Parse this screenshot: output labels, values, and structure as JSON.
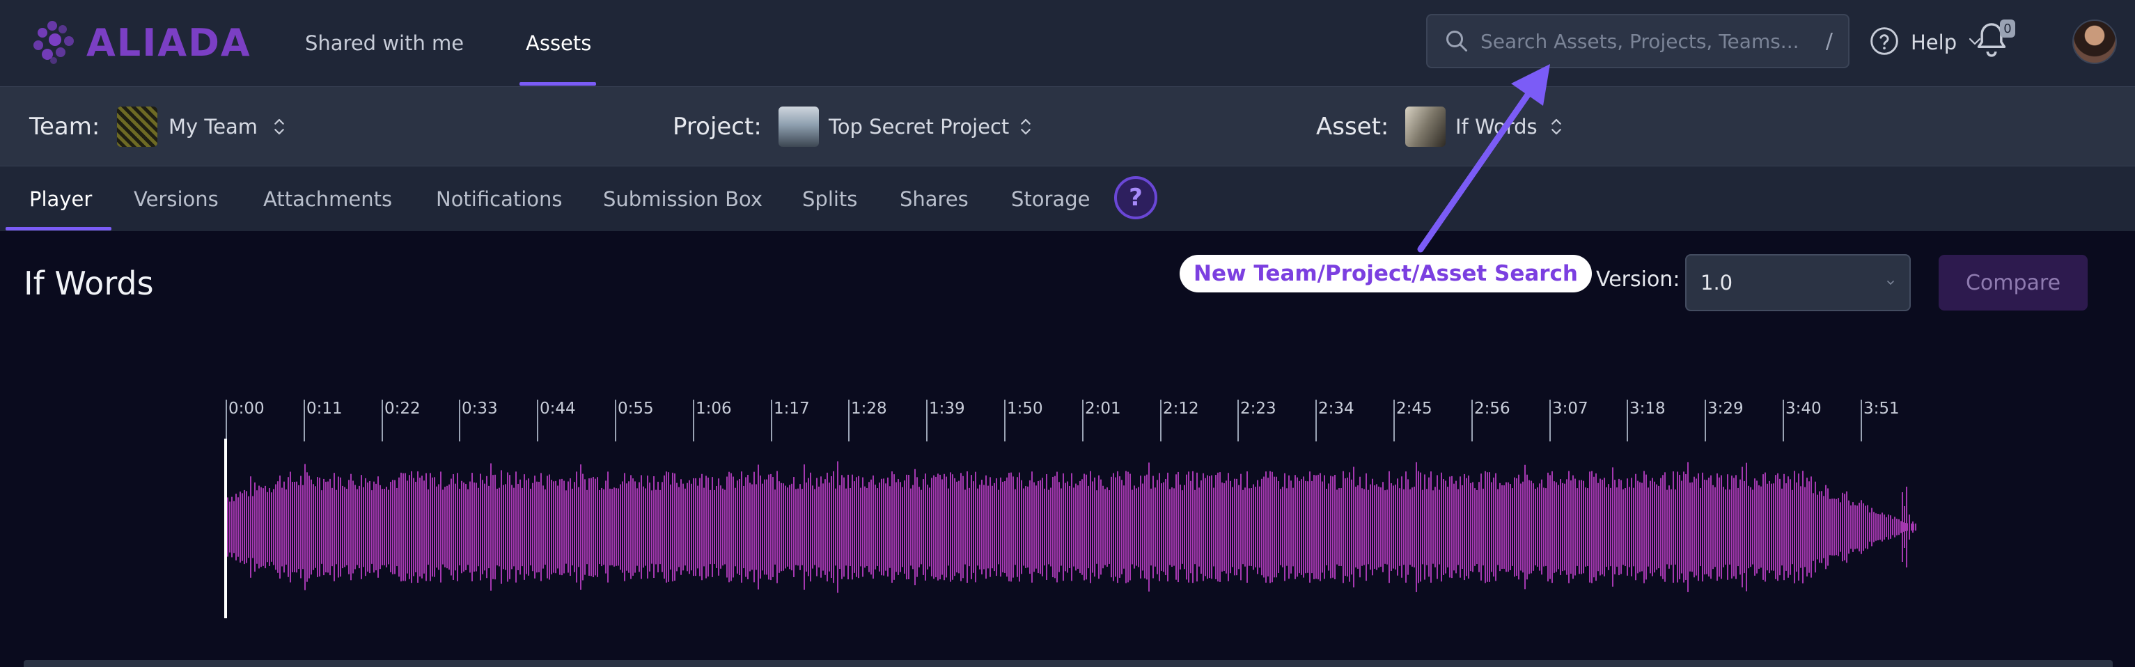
{
  "app": {
    "logo_text": "ALIADA",
    "accent": "#7b5cf6",
    "brand": "#7b3fc4"
  },
  "nav": {
    "shared_label": "Shared with me",
    "assets_label": "Assets"
  },
  "search": {
    "placeholder": "Search Assets, Projects, Teams...",
    "shortcut": "/"
  },
  "help": {
    "label": "Help"
  },
  "notifications": {
    "count": "0"
  },
  "context": {
    "team_label": "Team:",
    "team_value": "My Team",
    "project_label": "Project:",
    "project_value": "Top Secret Project",
    "asset_label": "Asset:",
    "asset_value": "If Words"
  },
  "tabs": [
    {
      "label": "Player"
    },
    {
      "label": "Versions"
    },
    {
      "label": "Attachments"
    },
    {
      "label": "Notifications"
    },
    {
      "label": "Submission Box"
    },
    {
      "label": "Splits"
    },
    {
      "label": "Shares"
    },
    {
      "label": "Storage"
    }
  ],
  "tab_help": "?",
  "main": {
    "title": "If Words",
    "callout": "New Team/Project/Asset Search",
    "version_label": "Version:",
    "version_value": "1.0",
    "compare_label": "Compare"
  },
  "timeline": {
    "ticks": [
      "0:00",
      "0:11",
      "0:22",
      "0:33",
      "0:44",
      "0:55",
      "1:06",
      "1:17",
      "1:28",
      "1:39",
      "1:50",
      "2:01",
      "2:12",
      "2:23",
      "2:34",
      "2:45",
      "2:56",
      "3:07",
      "3:18",
      "3:29",
      "3:40",
      "3:51"
    ],
    "waveform_color": "#a438b0"
  }
}
